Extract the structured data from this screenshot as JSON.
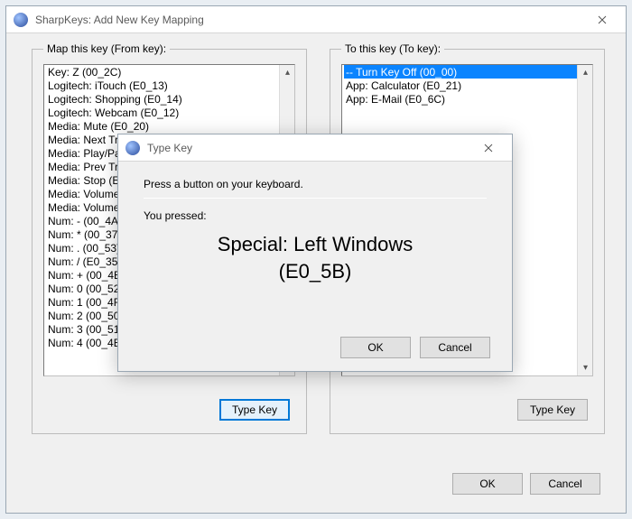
{
  "main": {
    "title": "SharpKeys: Add New Key Mapping",
    "from_group_label": "Map this key (From key):",
    "to_group_label": "To this key (To key):",
    "type_key_label": "Type Key",
    "ok_label": "OK",
    "cancel_label": "Cancel"
  },
  "from_items": [
    "Key: Z (00_2C)",
    "Logitech: iTouch (E0_13)",
    "Logitech: Shopping (E0_14)",
    "Logitech: Webcam (E0_12)",
    "Media: Mute (E0_20)",
    "Media: Next Track (E0_19)",
    "Media: Play/Pause (E0_22)",
    "Media: Prev Track (E0_10)",
    "Media: Stop (E0_24)",
    "Media: Volume Down (E0_2E)",
    "Media: Volume Up (E0_30)",
    "Num: - (00_4A)",
    "Num: * (00_37)",
    "Num: . (00_53)",
    "Num: / (E0_35)",
    "Num: + (00_4E)",
    "Num: 0 (00_52)",
    "Num: 1 (00_4F)",
    "Num: 2 (00_50)",
    "Num: 3 (00_51)",
    "Num: 4 (00_4B)"
  ],
  "to_items": [
    "-- Turn Key Off (00_00)",
    "App: Calculator (E0_21)",
    "App: E-Mail (E0_6C)"
  ],
  "to_selected_index": 0,
  "modal": {
    "title": "Type Key",
    "instruction": "Press a button on your keyboard.",
    "pressed_label": "You pressed:",
    "pressed_line1": "Special: Left Windows",
    "pressed_line2": "(E0_5B)",
    "ok_label": "OK",
    "cancel_label": "Cancel"
  }
}
